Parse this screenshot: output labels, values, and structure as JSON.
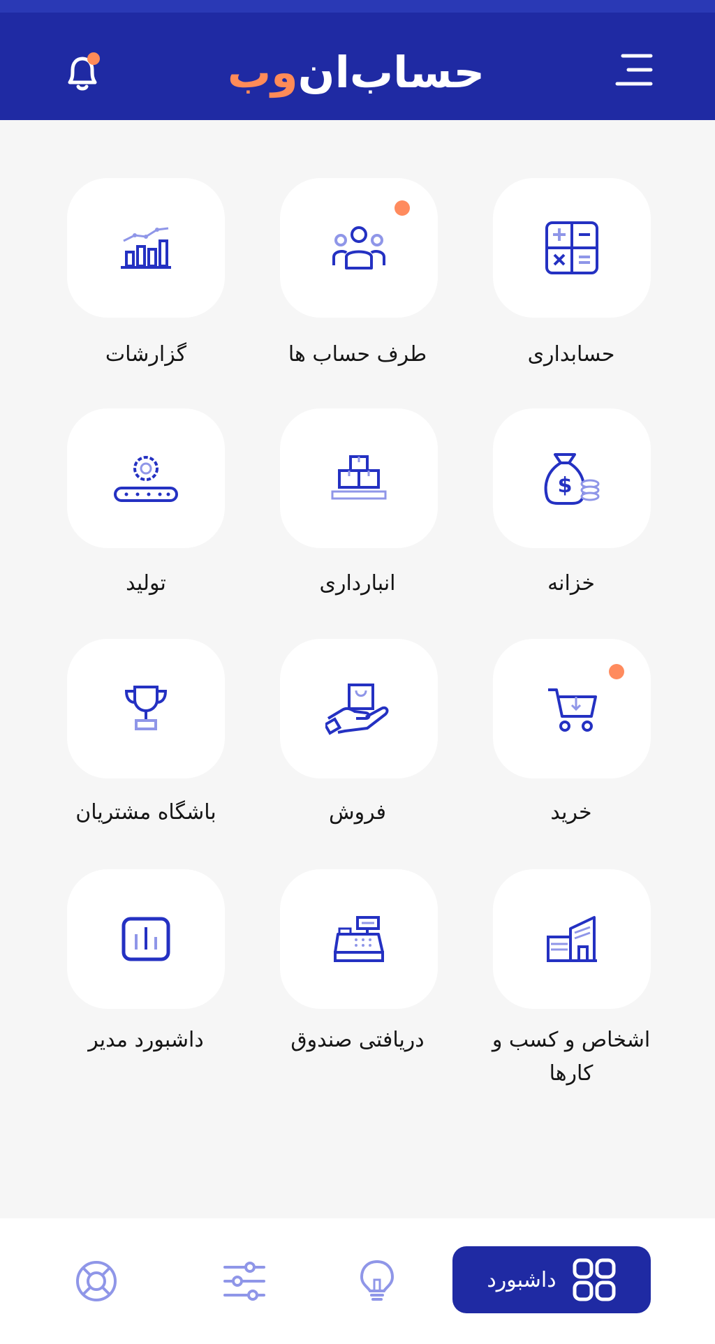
{
  "header": {
    "title_part1": "حساب",
    "title_part2": "ان",
    "title_part3": "وب",
    "brand_color": "#1f2aa3",
    "accent_color": "#ff8b58",
    "menu_icon": "menu-icon",
    "bell_icon": "bell-icon"
  },
  "tiles": [
    {
      "label": "حسابداری",
      "icon": "calculator-icon"
    },
    {
      "label": "طرف حساب ها",
      "icon": "people-icon"
    },
    {
      "label": "گزارشات",
      "icon": "chart-icon"
    },
    {
      "label": "خزانه",
      "icon": "money-bag-icon"
    },
    {
      "label": "انبارداری",
      "icon": "boxes-icon"
    },
    {
      "label": "تولید",
      "icon": "conveyor-gear-icon"
    },
    {
      "label": "خرید",
      "icon": "cart-icon"
    },
    {
      "label": "فروش",
      "icon": "hand-bag-icon"
    },
    {
      "label": "باشگاه مشتریان",
      "icon": "trophy-icon"
    },
    {
      "label": "اشخاص و کسب و کارها",
      "icon": "building-icon"
    },
    {
      "label": "دریافتی صندوق",
      "icon": "cash-register-icon"
    },
    {
      "label": "داشبورد مدیر",
      "icon": "dashboard-chart-icon"
    }
  ],
  "bottom_nav": {
    "dashboard_label": "داشبورد",
    "items": [
      "grid-icon",
      "bulb-icon",
      "sliders-icon",
      "support-icon"
    ]
  }
}
